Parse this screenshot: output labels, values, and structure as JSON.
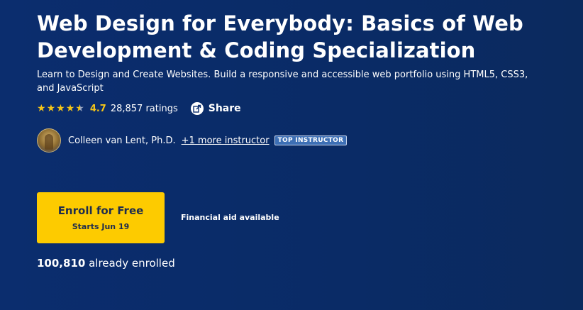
{
  "course": {
    "title": "Web Design for Everybody: Basics of Web Development & Coding Specialization",
    "subtitle": "Learn to Design and Create Websites. Build a responsive and accessible web portfolio using HTML5, CSS3, and JavaScript",
    "rating_value": "4.7",
    "rating_count": "28,857 ratings",
    "rating_stars": 4.7
  },
  "share": {
    "label": "Share",
    "icon": "share-icon"
  },
  "instructor": {
    "name": "Colleen van Lent, Ph.D.",
    "more": "+1 more instructor",
    "badge": "TOP INSTRUCTOR"
  },
  "enroll": {
    "label": "Enroll for Free",
    "sub": "Starts Jun 19",
    "aid": "Financial aid available",
    "enrolled_count": "100,810",
    "enrolled_suffix": " already enrolled"
  },
  "colors": {
    "background": "#0b2d6e",
    "accent": "#fdcb00",
    "star": "#f5c518",
    "badge": "#3d6fb5"
  }
}
